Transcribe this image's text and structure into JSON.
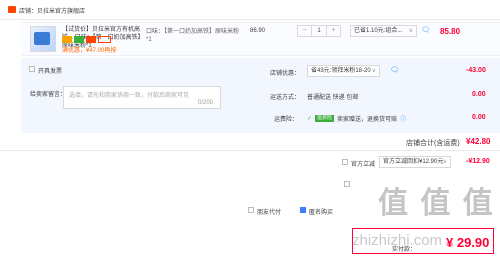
{
  "shop": {
    "label": "店铺：贝拉米官方旗舰店"
  },
  "item": {
    "title": "【试货价】贝拉米官方有机高铁... 口味：【第一口奶加高铁】原味米粉*1",
    "promo": "满优惠，¥47.00再按",
    "sku": "口味：【第一口奶加高铁】原味米粉*1",
    "unit_price": "86.90",
    "qty_minus": "−",
    "qty": "1",
    "qty_plus": "+",
    "discount_select": "已省1.10元:组合...",
    "total": "85.80"
  },
  "invoice": {
    "label": "开具发票"
  },
  "message": {
    "label": "给卖家留言：",
    "placeholder": "选填，请先和商家协商一致，付款后商家可见",
    "count": "0/200"
  },
  "store_promo": {
    "label": "店铺优惠：",
    "select": "省43元:领拜米粉18-20",
    "value": "-43.00"
  },
  "shipping": {
    "label": "运送方式：",
    "text": "普通配送 快递 包邮",
    "value": "0.00"
  },
  "insurance": {
    "label": "运费险：",
    "tag": "运费险",
    "text": "卖家赠送，退换货可赔",
    "value": "0.00"
  },
  "store_total": {
    "label": "店铺合计(含运费)",
    "value": "¥42.80"
  },
  "official": {
    "label": "官方立减",
    "select": "官方立减回扣¥12.90元",
    "value": "-¥12.90"
  },
  "watermark": {
    "text": "值 值 值",
    "url": "zhizhizhi.com"
  },
  "friend_pay": {
    "label": "朋友代付"
  },
  "anon_buy": {
    "label": "匿名购买"
  },
  "final": {
    "label": "实付款：",
    "value": "¥ 29.90"
  },
  "colors": {
    "accent": "#ff0036",
    "brand": "#ff4400",
    "link": "#3c7efb",
    "panel": "#f2f7ff"
  },
  "icons": {
    "shop": "shop-icon",
    "chat": "chat-icon",
    "chevron": "chevron-down-icon"
  }
}
